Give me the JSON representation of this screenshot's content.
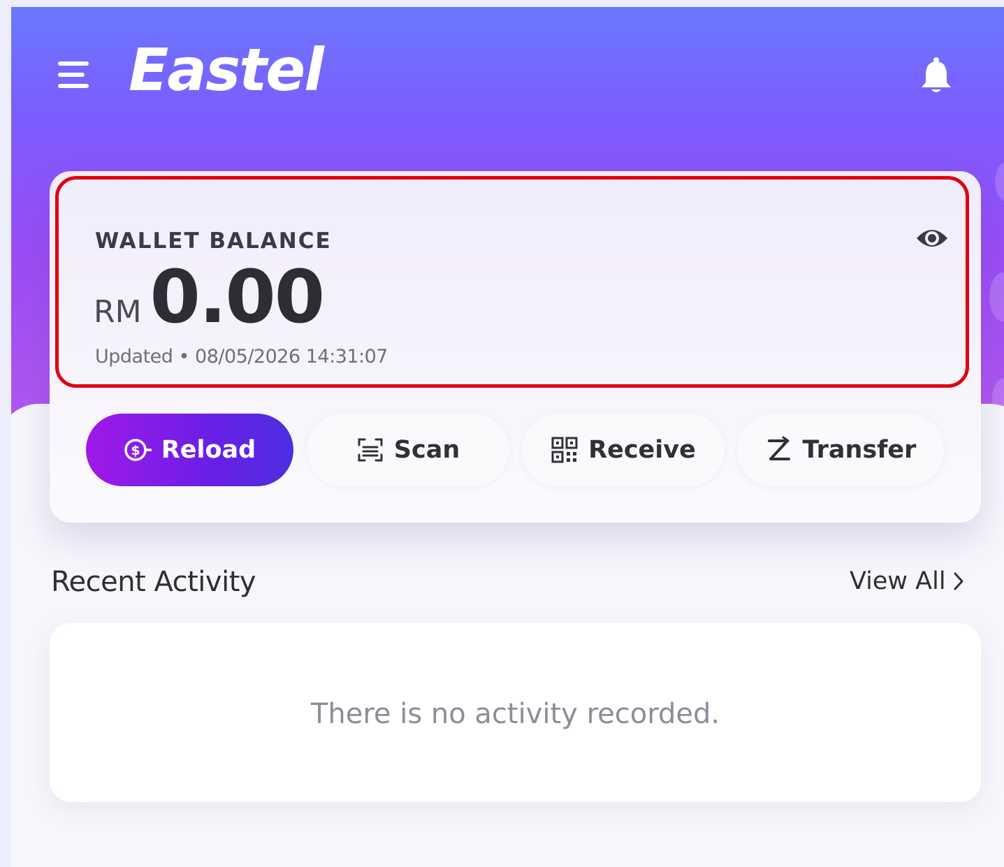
{
  "header": {
    "brand": "Eastel",
    "menu_icon": "hamburger-menu-icon",
    "notification_icon": "bell-icon"
  },
  "wallet": {
    "label": "WALLET BALANCE",
    "currency": "RM",
    "amount": "0.00",
    "updated": "Updated • 08/05/2026 14:31:07",
    "visibility_icon": "eye-icon"
  },
  "actions": [
    {
      "label": "Reload",
      "icon": "dollar-coin-icon"
    },
    {
      "label": "Scan",
      "icon": "scan-icon"
    },
    {
      "label": "Receive",
      "icon": "qr-code-icon"
    },
    {
      "label": "Transfer",
      "icon": "transfer-icon"
    }
  ],
  "activity": {
    "title": "Recent Activity",
    "view_all": "View All",
    "empty_message": "There is no activity recorded."
  },
  "colors": {
    "primary_gradient_start": "#6a78ff",
    "primary_gradient_end": "#b458ee",
    "reload_button_start": "#a019e8",
    "reload_button_end": "#4c2ee0",
    "highlight_border": "#e0000f"
  }
}
